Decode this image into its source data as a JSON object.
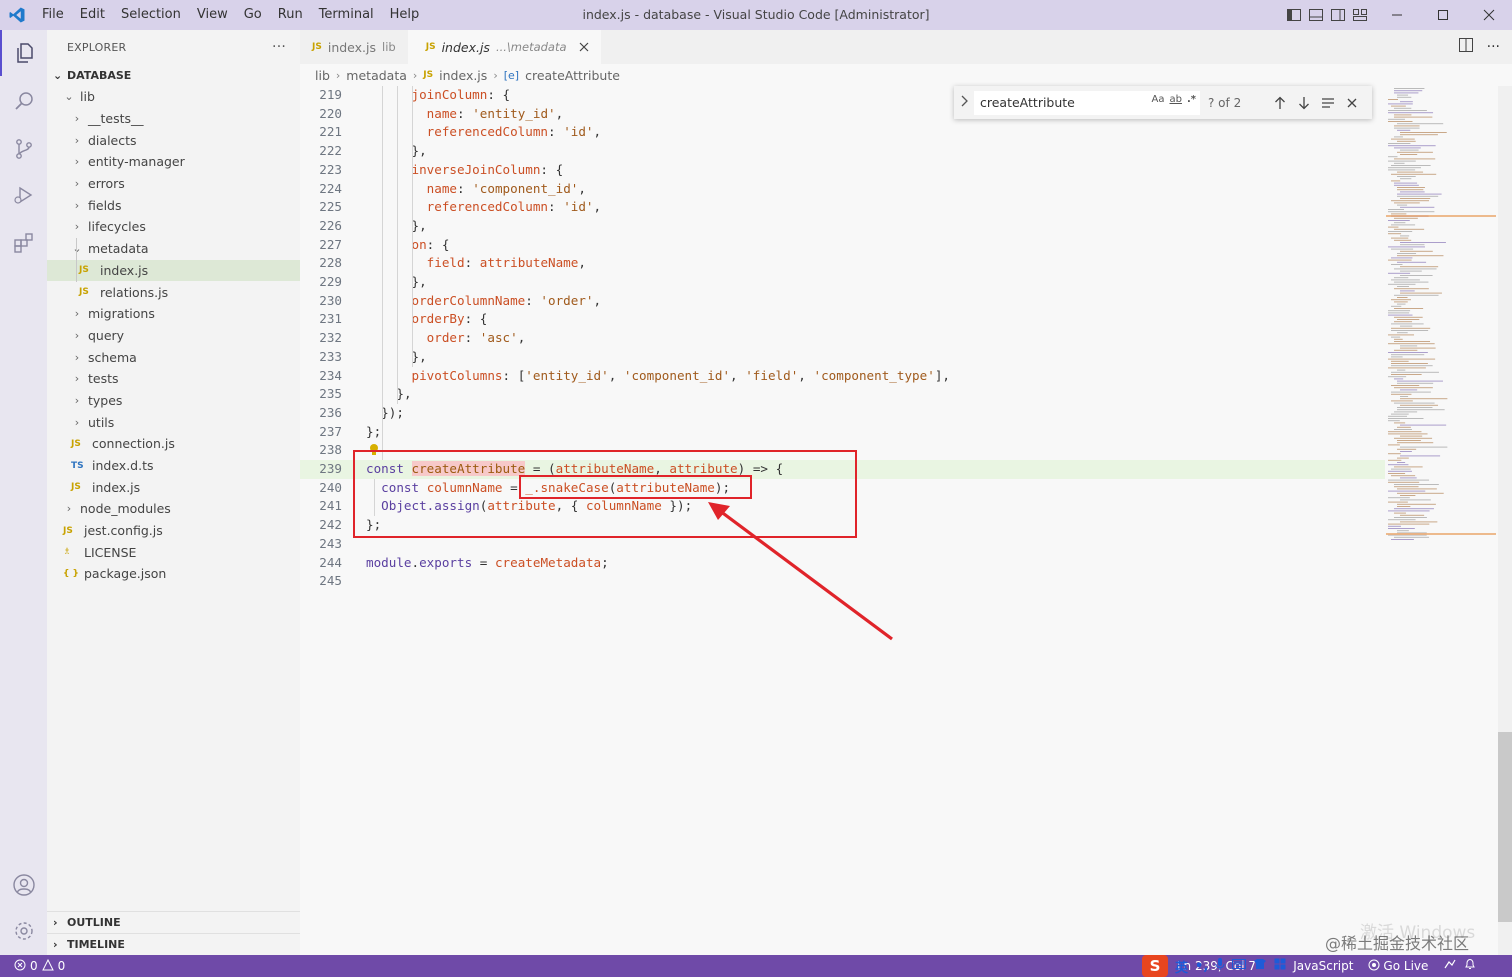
{
  "window": {
    "title": "index.js - database - Visual Studio Code [Administrator]",
    "menus": [
      "File",
      "Edit",
      "Selection",
      "View",
      "Go",
      "Run",
      "Terminal",
      "Help"
    ]
  },
  "sidebar": {
    "header": "EXPLORER",
    "more": "···",
    "root": "DATABASE",
    "tree": [
      {
        "label": "lib",
        "type": "folder-open",
        "depth": 1
      },
      {
        "label": "__tests__",
        "type": "folder",
        "depth": 2
      },
      {
        "label": "dialects",
        "type": "folder",
        "depth": 2
      },
      {
        "label": "entity-manager",
        "type": "folder",
        "depth": 2
      },
      {
        "label": "errors",
        "type": "folder",
        "depth": 2
      },
      {
        "label": "fields",
        "type": "folder",
        "depth": 2
      },
      {
        "label": "lifecycles",
        "type": "folder",
        "depth": 2
      },
      {
        "label": "metadata",
        "type": "folder-open",
        "depth": 2
      },
      {
        "label": "index.js",
        "type": "js",
        "depth": 3,
        "selected": true
      },
      {
        "label": "relations.js",
        "type": "js",
        "depth": 3
      },
      {
        "label": "migrations",
        "type": "folder",
        "depth": 2
      },
      {
        "label": "query",
        "type": "folder",
        "depth": 2
      },
      {
        "label": "schema",
        "type": "folder",
        "depth": 2
      },
      {
        "label": "tests",
        "type": "folder",
        "depth": 2
      },
      {
        "label": "types",
        "type": "folder",
        "depth": 2
      },
      {
        "label": "utils",
        "type": "folder",
        "depth": 2
      },
      {
        "label": "connection.js",
        "type": "js",
        "depth": 2
      },
      {
        "label": "index.d.ts",
        "type": "ts",
        "depth": 2
      },
      {
        "label": "index.js",
        "type": "js",
        "depth": 2
      },
      {
        "label": "node_modules",
        "type": "folder",
        "depth": 1
      },
      {
        "label": "jest.config.js",
        "type": "js",
        "depth": 1
      },
      {
        "label": "LICENSE",
        "type": "lic",
        "depth": 1
      },
      {
        "label": "package.json",
        "type": "json",
        "depth": 1
      }
    ],
    "outline": "OUTLINE",
    "timeline": "TIMELINE"
  },
  "tabs": [
    {
      "label": "index.js",
      "desc": "lib",
      "active": false
    },
    {
      "label": "index.js",
      "desc": "...\\metadata",
      "active": true
    }
  ],
  "breadcrumb": [
    "lib",
    "metadata",
    "index.js",
    "createAttribute"
  ],
  "find": {
    "query": "createAttribute",
    "count": "? of 2",
    "opt_case": "Aa",
    "opt_word": "ab",
    "opt_regex": ".*"
  },
  "code": {
    "lines": [
      {
        "n": "219",
        "t": "      joinColumn: {"
      },
      {
        "n": "220",
        "t": "        name: 'entity_id',"
      },
      {
        "n": "221",
        "t": "        referencedColumn: 'id',"
      },
      {
        "n": "222",
        "t": "      },"
      },
      {
        "n": "223",
        "t": "      inverseJoinColumn: {"
      },
      {
        "n": "224",
        "t": "        name: 'component_id',"
      },
      {
        "n": "225",
        "t": "        referencedColumn: 'id',"
      },
      {
        "n": "226",
        "t": "      },"
      },
      {
        "n": "227",
        "t": "      on: {"
      },
      {
        "n": "228",
        "t": "        field: attributeName,"
      },
      {
        "n": "229",
        "t": "      },"
      },
      {
        "n": "230",
        "t": "      orderColumnName: 'order',"
      },
      {
        "n": "231",
        "t": "      orderBy: {"
      },
      {
        "n": "232",
        "t": "        order: 'asc',"
      },
      {
        "n": "233",
        "t": "      },"
      },
      {
        "n": "234",
        "t": "      pivotColumns: ['entity_id', 'component_id', 'field', 'component_type'],"
      },
      {
        "n": "235",
        "t": "    },"
      },
      {
        "n": "236",
        "t": "  });"
      },
      {
        "n": "237",
        "t": "};"
      },
      {
        "n": "238",
        "t": ""
      },
      {
        "n": "239",
        "t": "const createAttribute = (attributeName, attribute) => {"
      },
      {
        "n": "240",
        "t": "  const columnName = _.snakeCase(attributeName);"
      },
      {
        "n": "241",
        "t": "  Object.assign(attribute, { columnName });"
      },
      {
        "n": "242",
        "t": "};"
      },
      {
        "n": "243",
        "t": ""
      },
      {
        "n": "244",
        "t": "module.exports = createMetadata;"
      },
      {
        "n": "245",
        "t": ""
      }
    ]
  },
  "status": {
    "problems": "0",
    "warnings": "0",
    "position": "Ln 239, Col 7",
    "language": "JavaScript",
    "golive": "Go Live",
    "ime_lang": "英"
  },
  "watermark": "@稀土掘金技术社区",
  "watermark_faint": "激活 Windows"
}
